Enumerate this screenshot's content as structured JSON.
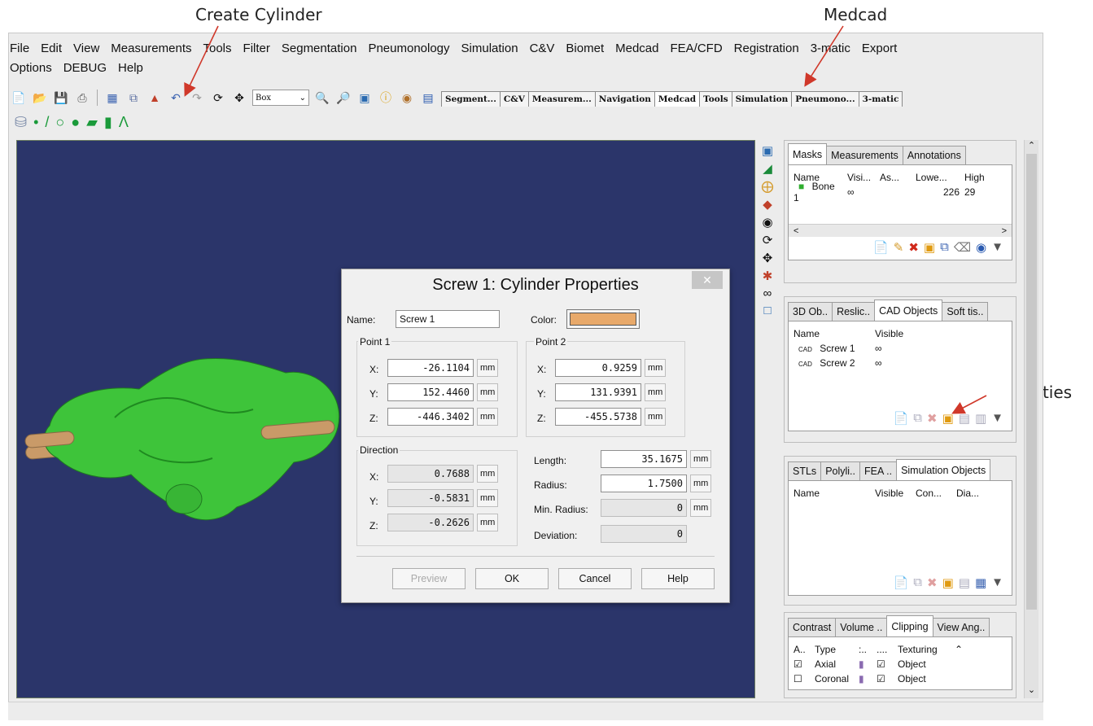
{
  "annotations": {
    "create_cylinder": "Create Cylinder",
    "medcad": "Medcad",
    "properties": "Properties"
  },
  "menu": {
    "row1": [
      "File",
      "Edit",
      "View",
      "Measurements",
      "Tools",
      "Filter",
      "Segmentation",
      "Pneumonology",
      "Simulation",
      "C&V",
      "Biomet",
      "Medcad",
      "FEA/CFD",
      "Registration",
      "3-matic",
      "Export"
    ],
    "row2": [
      "Options",
      "DEBUG",
      "Help"
    ]
  },
  "toolbar": {
    "selection_mode": "Box",
    "tabs": [
      "Segment...",
      "C&V",
      "Measurem...",
      "Navigation",
      "Medcad",
      "Tools",
      "Simulation",
      "Pneumono...",
      "3-matic"
    ],
    "active_tab": "Medcad"
  },
  "masks_panel": {
    "tabs": [
      "Masks",
      "Measurements",
      "Annotations"
    ],
    "columns": [
      "Name",
      "Visi...",
      "As...",
      "Lowe...",
      "High"
    ],
    "rows": [
      {
        "name": "Bone 1",
        "lower": "226",
        "high": "29"
      }
    ]
  },
  "objects_panel": {
    "tabs": [
      "3D Ob..",
      "Reslic..",
      "CAD Objects",
      "Soft tis.."
    ],
    "columns": [
      "Name",
      "Visible"
    ],
    "rows": [
      {
        "prefix": "CAD",
        "name": "Screw 1"
      },
      {
        "prefix": "CAD",
        "name": "Screw 2"
      }
    ]
  },
  "simulation_panel": {
    "tabs": [
      "STLs",
      "Polyli..",
      "FEA ..",
      "Simulation Objects"
    ],
    "columns": [
      "Name",
      "Visible",
      "Con...",
      "Dia..."
    ]
  },
  "clipping_panel": {
    "tabs": [
      "Contrast",
      "Volume ..",
      "Clipping",
      "View Ang.."
    ],
    "columns": [
      "A..",
      "Type",
      ":..",
      "....",
      "Texturing"
    ],
    "rows": [
      {
        "type": "Axial",
        "texturing": "Object"
      },
      {
        "type": "Coronal",
        "texturing": "Object"
      }
    ]
  },
  "dialog": {
    "title": "Screw 1: Cylinder Properties",
    "name_label": "Name:",
    "name_value": "Screw 1",
    "color_label": "Color:",
    "color_value": "#e8a96a",
    "point1_label": "Point 1",
    "point2_label": "Point 2",
    "direction_label": "Direction",
    "x_label": "X:",
    "y_label": "Y:",
    "z_label": "Z:",
    "unit": "mm",
    "point1": {
      "x": "-26.1104",
      "y": "152.4460",
      "z": "-446.3402"
    },
    "point2": {
      "x": "0.9259",
      "y": "131.9391",
      "z": "-455.5738"
    },
    "direction": {
      "x": "0.7688",
      "y": "-0.5831",
      "z": "-0.2626"
    },
    "length_label": "Length:",
    "length": "35.1675",
    "radius_label": "Radius:",
    "radius": "1.7500",
    "min_radius_label": "Min. Radius:",
    "min_radius": "0",
    "deviation_label": "Deviation:",
    "deviation": "0",
    "buttons": {
      "preview": "Preview",
      "ok": "OK",
      "cancel": "Cancel",
      "help": "Help"
    }
  }
}
